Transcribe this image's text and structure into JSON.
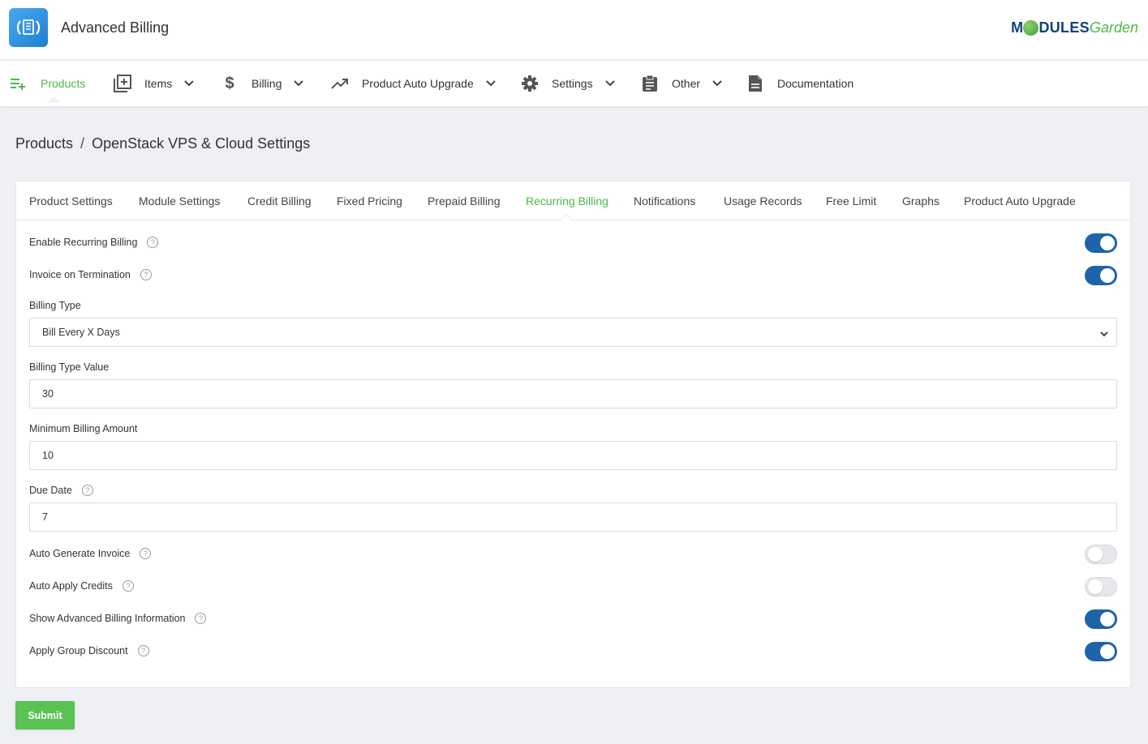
{
  "app": {
    "title": "Advanced Billing"
  },
  "brand": {
    "strong_left": "M",
    "strong_right": "DULES",
    "light": "Garden"
  },
  "nav": {
    "items": [
      {
        "label": "Products",
        "icon": "playlist-add-icon",
        "dropdown": false,
        "active": true
      },
      {
        "label": "Items",
        "icon": "library-add-icon",
        "dropdown": true
      },
      {
        "label": "Billing",
        "icon": "dollar-icon",
        "dropdown": true
      },
      {
        "label": "Product Auto Upgrade",
        "icon": "trending-up-icon",
        "dropdown": true
      },
      {
        "label": "Settings",
        "icon": "gear-icon",
        "dropdown": true
      },
      {
        "label": "Other",
        "icon": "clipboard-icon",
        "dropdown": true
      },
      {
        "label": "Documentation",
        "icon": "document-icon",
        "dropdown": false
      }
    ]
  },
  "breadcrumb": {
    "root": "Products",
    "separator": "/",
    "current": "OpenStack VPS & Cloud Settings"
  },
  "tabs": [
    "Product Settings",
    "Module Settings",
    "Credit Billing",
    "Fixed Pricing",
    "Prepaid Billing",
    "Recurring Billing",
    "Notifications",
    "Usage Records",
    "Free Limit",
    "Graphs",
    "Product Auto Upgrade"
  ],
  "active_tab": "Recurring Billing",
  "form": {
    "enable_recurring_billing": {
      "label": "Enable Recurring Billing",
      "on": true
    },
    "invoice_on_termination": {
      "label": "Invoice on Termination",
      "on": true
    },
    "billing_type": {
      "label": "Billing Type",
      "value": "Bill Every X Days"
    },
    "billing_type_value": {
      "label": "Billing Type Value",
      "value": "30"
    },
    "minimum_billing_amount": {
      "label": "Minimum Billing Amount",
      "value": "10"
    },
    "due_date": {
      "label": "Due Date",
      "value": "7"
    },
    "auto_generate_invoice": {
      "label": "Auto Generate Invoice",
      "on": false
    },
    "auto_apply_credits": {
      "label": "Auto Apply Credits",
      "on": false
    },
    "show_advanced_billing_information": {
      "label": "Show Advanced Billing Information",
      "on": true
    },
    "apply_group_discount": {
      "label": "Apply Group Discount",
      "on": true
    }
  },
  "submit": {
    "label": "Submit"
  },
  "colors": {
    "accent": "#4cb847",
    "toggle_on": "#1e64a8",
    "submit": "#5ac153",
    "brand_dark": "#13427a"
  }
}
